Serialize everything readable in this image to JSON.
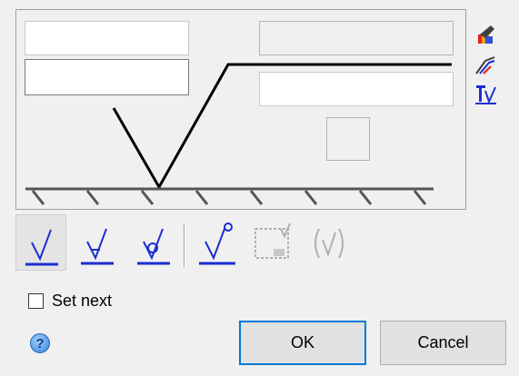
{
  "set_next": {
    "label": "Set next",
    "checked": false
  },
  "buttons": {
    "ok": "OK",
    "cancel": "Cancel",
    "help_glyph": "?"
  },
  "symbol_types": [
    {
      "name": "basic-surface-symbol",
      "selected": true
    },
    {
      "name": "material-removal-required-symbol",
      "selected": false
    },
    {
      "name": "material-removal-prohibited-symbol",
      "selected": false
    },
    {
      "name": "all-around-symbol",
      "selected": false
    },
    {
      "name": "jis-surface-symbol",
      "selected": false,
      "enabled": false
    },
    {
      "name": "parenthesized-symbol",
      "selected": false,
      "enabled": false
    }
  ],
  "side_tools": [
    "format-painter-icon",
    "leader-style-icon",
    "symbol-layout-icon"
  ],
  "colors": {
    "accent": "#0078d7",
    "symbol_blue": "#1c2fd0"
  }
}
